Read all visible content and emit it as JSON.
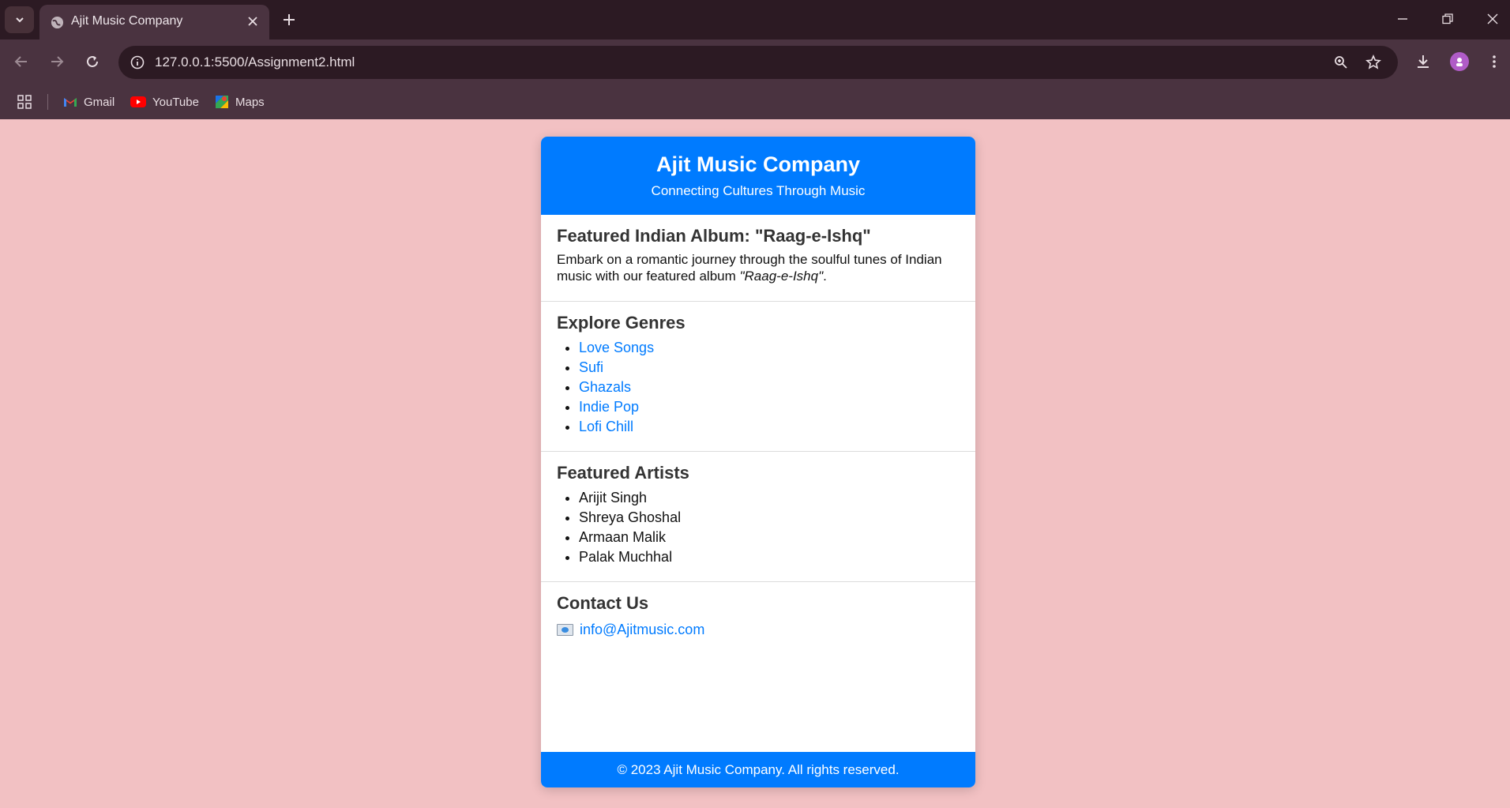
{
  "browser": {
    "tab": {
      "title": "Ajit Music Company"
    },
    "url": "127.0.0.1:5500/Assignment2.html",
    "bookmarks": [
      {
        "label": "Gmail",
        "icon": "gmail-icon"
      },
      {
        "label": "YouTube",
        "icon": "youtube-icon"
      },
      {
        "label": "Maps",
        "icon": "maps-icon"
      }
    ]
  },
  "page": {
    "header": {
      "title": "Ajit Music Company",
      "subtitle": "Connecting Cultures Through Music"
    },
    "featured_album": {
      "heading": "Featured Indian Album: \"Raag-e-Ishq\"",
      "text_before": "Embark on a romantic journey through the soulful tunes of Indian music with our featured album ",
      "album_name": "\"Raag-e-Ishq\"",
      "text_after": "."
    },
    "genres": {
      "heading": "Explore Genres",
      "items": [
        "Love Songs",
        "Sufi",
        "Ghazals",
        "Indie Pop",
        "Lofi Chill"
      ]
    },
    "artists": {
      "heading": "Featured Artists",
      "items": [
        "Arijit Singh",
        "Shreya Ghoshal",
        "Armaan Malik",
        "Palak Muchhal"
      ]
    },
    "contact": {
      "heading": "Contact Us",
      "email": "info@Ajitmusic.com",
      "icon": "envelope-icon"
    },
    "footer": "© 2023 Ajit Music Company. All rights reserved."
  },
  "colors": {
    "page_background": "#f2c1c3",
    "accent": "#007bff",
    "browser_frame": "#2c1a23",
    "toolbar": "#4a3340"
  }
}
